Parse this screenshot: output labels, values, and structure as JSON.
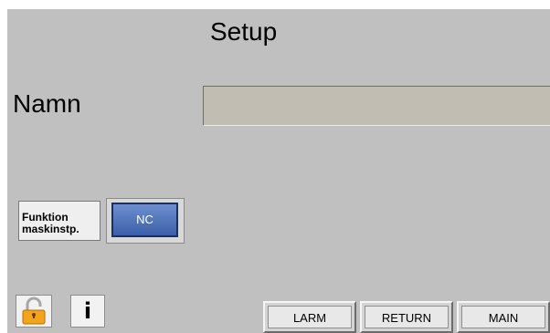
{
  "header": {
    "title": "Setup"
  },
  "name_row": {
    "label": "Namn",
    "value": ""
  },
  "function_row": {
    "label": "Funktion\nmaskinstp.",
    "button_label": "NC",
    "button_color": "#4a6db8"
  },
  "bottom_left": {
    "lock_icon": "padlock-unlocked-icon",
    "info_icon": "info-icon",
    "info_glyph": "i"
  },
  "nav": {
    "larm_label": "LARM",
    "return_label": "RETURN",
    "main_label": "MAIN"
  },
  "colors": {
    "background": "#c0c0c0",
    "input_field": "#c1bdb3",
    "lock_accent": "#f2a51c"
  }
}
